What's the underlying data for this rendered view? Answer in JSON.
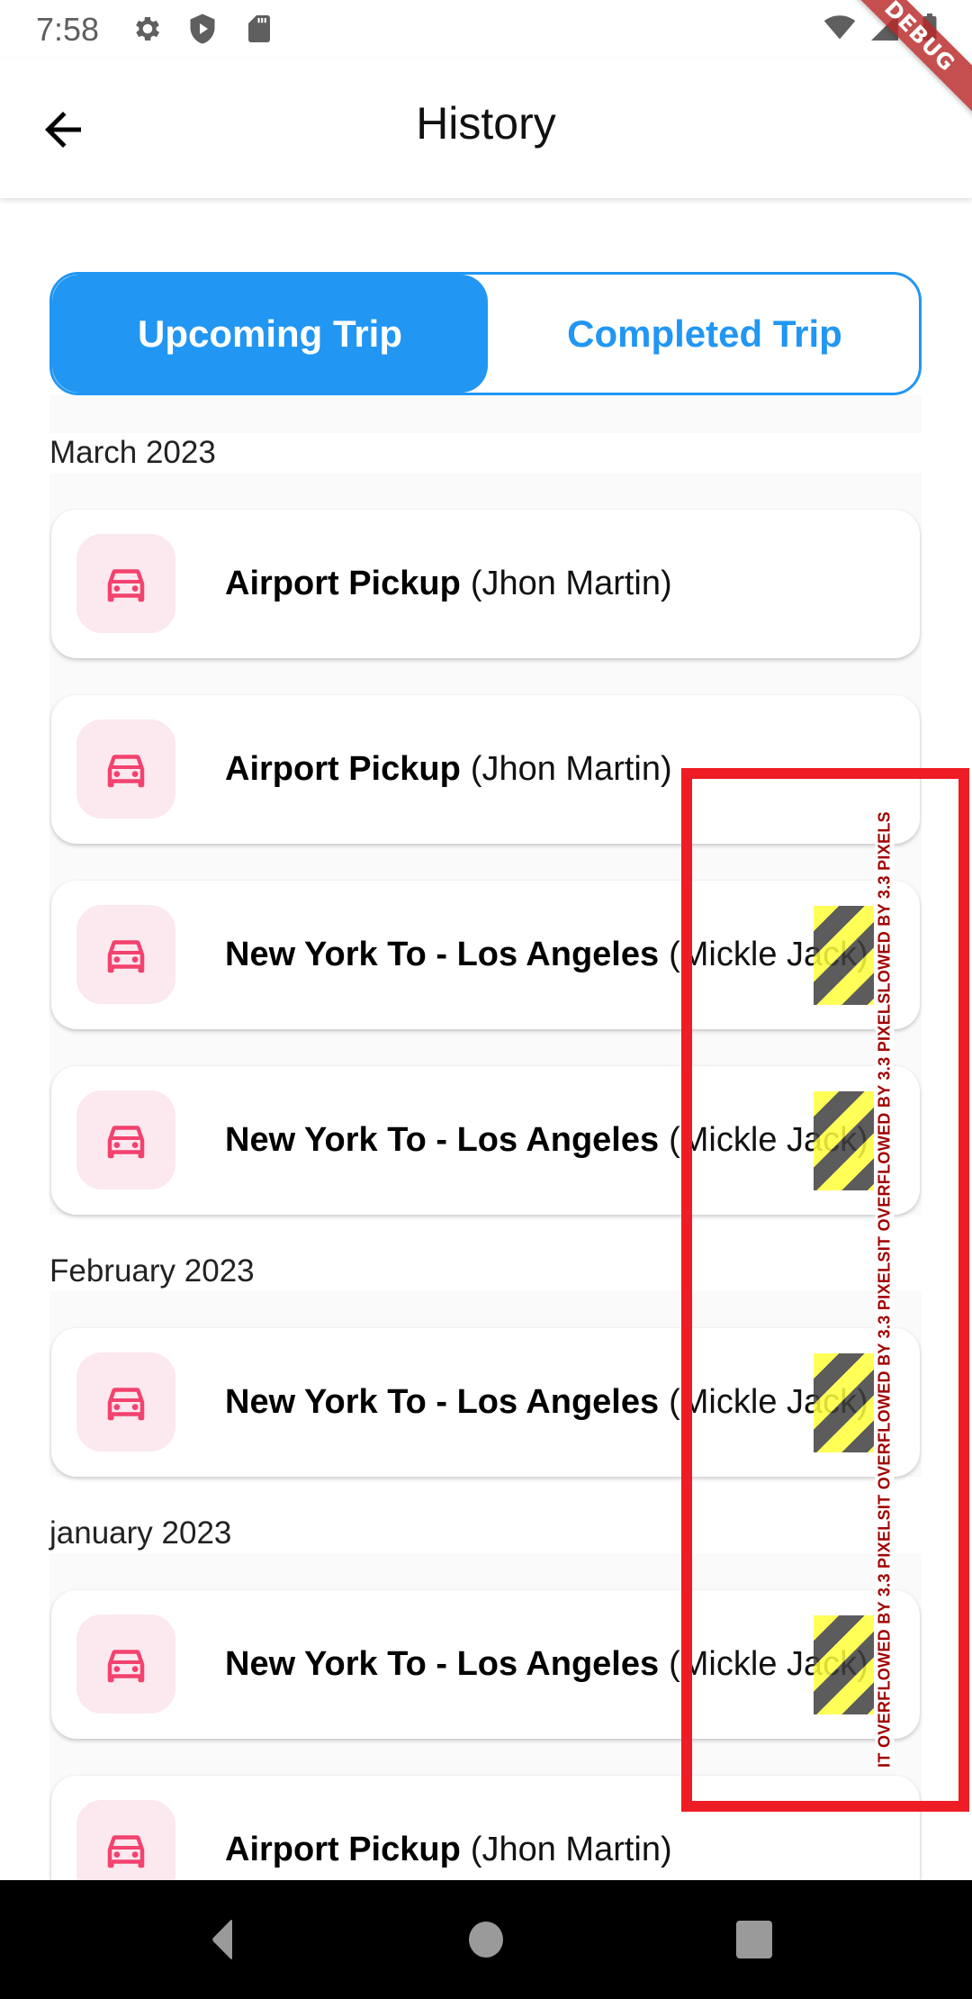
{
  "status_bar": {
    "time": "7:58",
    "left_icons": [
      "gear-icon",
      "shield-play-icon",
      "sd-card-icon"
    ],
    "right_icons": [
      "wifi-icon",
      "signal-icon",
      "battery-icon"
    ]
  },
  "debug_banner": "DEBUG",
  "app_bar": {
    "back_icon": "arrow-left-icon",
    "title": "History"
  },
  "tabs": [
    {
      "label": "Upcoming Trip",
      "selected": true
    },
    {
      "label": "Completed Trip",
      "selected": false
    }
  ],
  "colors": {
    "accent": "#2196F3",
    "icon_pink": "#F2426E",
    "icon_bg": "#FCE8EF",
    "overflow_red": "#EE1C24"
  },
  "sections": [
    {
      "header": "March 2023",
      "trips": [
        {
          "title": "Airport Pickup",
          "name": "(Jhon Martin)",
          "icon": "car-icon"
        },
        {
          "title": "Airport Pickup",
          "name": "(Jhon Martin)",
          "icon": "car-icon"
        },
        {
          "title": "New York To - Los Angeles",
          "name": "(Mickle Jack)",
          "icon": "car-icon",
          "overflow": true
        },
        {
          "title": "New York To - Los Angeles",
          "name": "(Mickle Jack)",
          "icon": "car-icon",
          "overflow": true
        }
      ]
    },
    {
      "header": "February 2023",
      "trips": [
        {
          "title": "New York To - Los Angeles",
          "name": "(Mickle Jack)",
          "icon": "car-icon",
          "overflow": true
        }
      ]
    },
    {
      "header": "january 2023",
      "trips": [
        {
          "title": "New York To - Los Angeles",
          "name": "(Mickle Jack)",
          "icon": "car-icon",
          "overflow": true
        },
        {
          "title": "Airport Pickup",
          "name": "(Jhon Martin)",
          "icon": "car-icon"
        }
      ]
    }
  ],
  "overflow_warning": "IT OVERFLOWED BY 3.3 PIXELSIT OVERFLOWED BY 3.3 PIXELSIT OVERFLOWED BY 3.3 PIXELSLOWED BY 3.3 PIXELS",
  "nav_bar": {
    "back": "nav-back-icon",
    "home": "nav-home-icon",
    "recents": "nav-recents-icon"
  }
}
